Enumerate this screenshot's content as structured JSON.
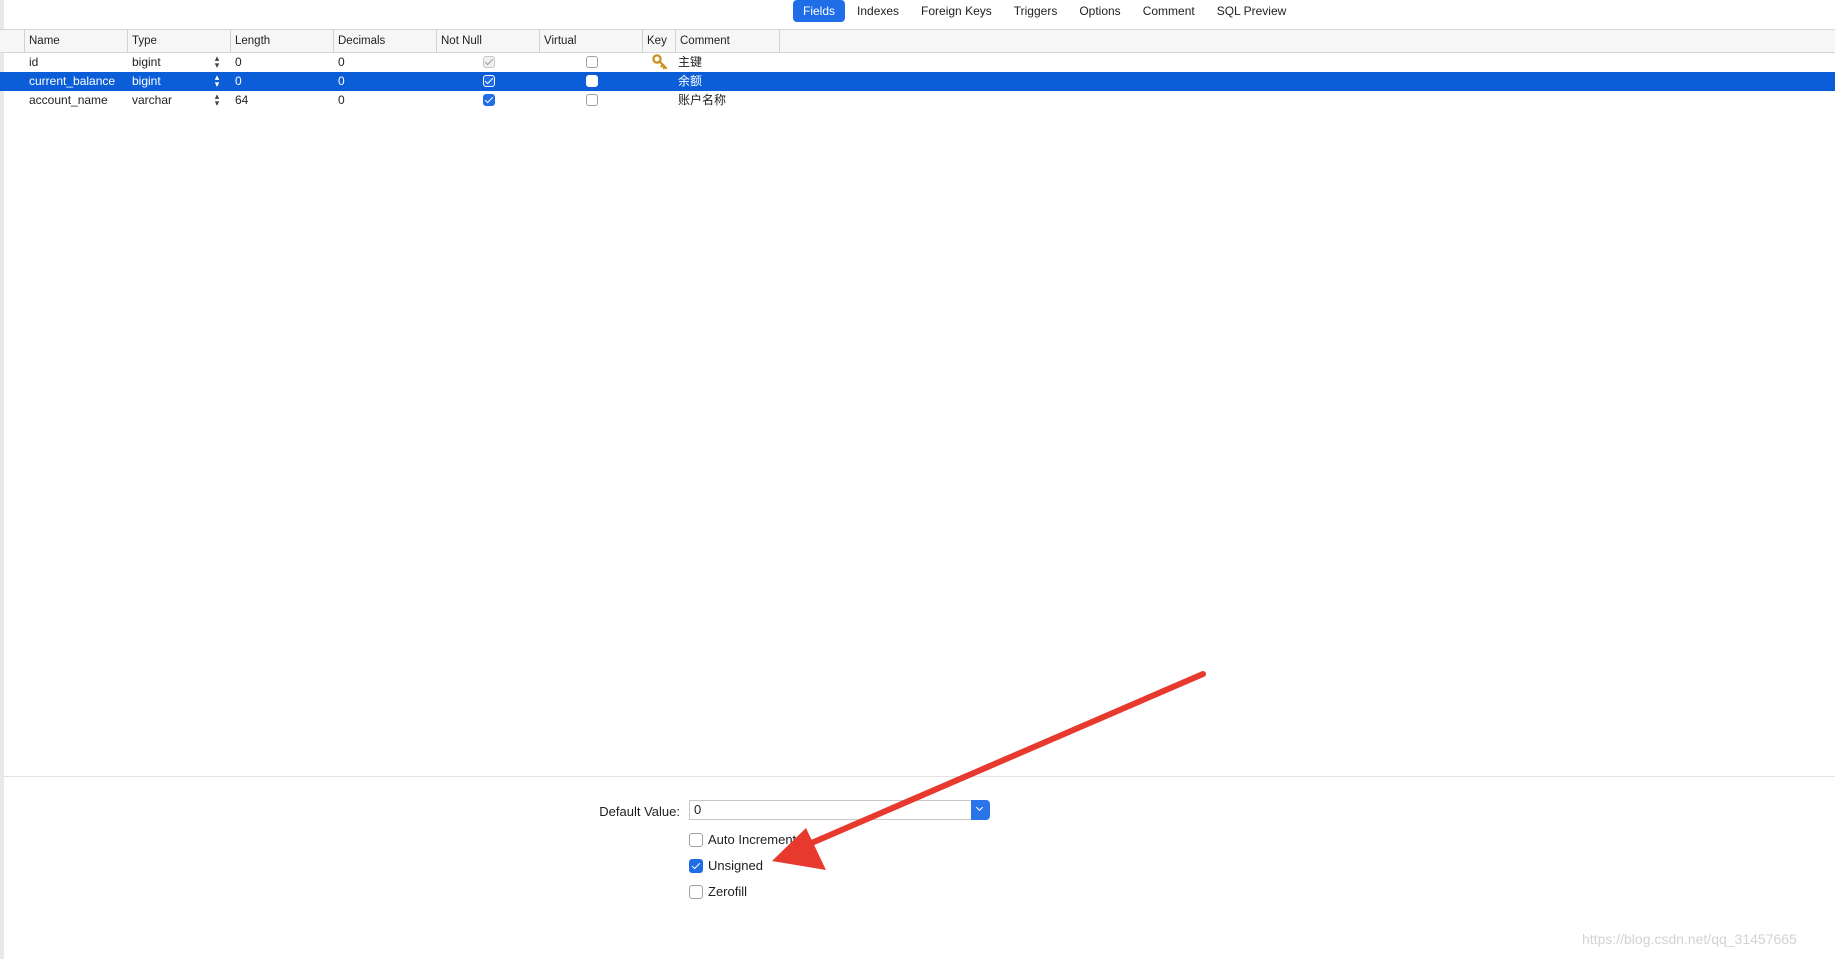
{
  "tabs": [
    {
      "label": "Fields",
      "active": true
    },
    {
      "label": "Indexes",
      "active": false
    },
    {
      "label": "Foreign Keys",
      "active": false
    },
    {
      "label": "Triggers",
      "active": false
    },
    {
      "label": "Options",
      "active": false
    },
    {
      "label": "Comment",
      "active": false
    },
    {
      "label": "SQL Preview",
      "active": false
    }
  ],
  "columns": [
    "Name",
    "Type",
    "Length",
    "Decimals",
    "Not Null",
    "Virtual",
    "Key",
    "Comment"
  ],
  "rows": [
    {
      "name": "id",
      "type": "bigint",
      "length": "0",
      "decimals": "0",
      "not_null": true,
      "not_null_locked": true,
      "virtual": false,
      "key": true,
      "comment": "主键",
      "selected": false
    },
    {
      "name": "current_balance",
      "type": "bigint",
      "length": "0",
      "decimals": "0",
      "not_null": true,
      "not_null_locked": false,
      "virtual": false,
      "key": false,
      "comment": "余额",
      "selected": true
    },
    {
      "name": "account_name",
      "type": "varchar",
      "length": "64",
      "decimals": "0",
      "not_null": true,
      "not_null_locked": false,
      "virtual": false,
      "key": false,
      "comment": "账户名称",
      "selected": false
    }
  ],
  "field_props": {
    "default_value_label": "Default Value:",
    "default_value": "0",
    "options": [
      {
        "label": "Auto Increment",
        "checked": false
      },
      {
        "label": "Unsigned",
        "checked": true
      },
      {
        "label": "Zerofill",
        "checked": false
      }
    ]
  },
  "icons": {
    "key": "key-icon",
    "stepper": "stepper-icon",
    "dropdown": "chevron-down-icon"
  },
  "colors": {
    "accent": "#1f6ee8",
    "selection": "#0b5ed7",
    "annotation_arrow": "#e8392f"
  },
  "watermark": "https://blog.csdn.net/qq_31457665"
}
